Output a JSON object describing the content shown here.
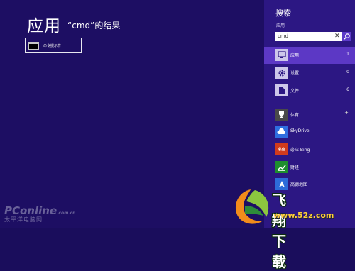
{
  "main": {
    "title": "应用",
    "subtitle": "“cmd”的结果",
    "results": [
      {
        "label": "命令提示符",
        "icon": "command-prompt-icon"
      }
    ]
  },
  "search_panel": {
    "title": "搜索",
    "scope_label": "应用",
    "search_value": "cmd",
    "clear_icon": "close-icon",
    "search_icon": "magnifier-icon",
    "categories": [
      {
        "label": "应用",
        "count": "1",
        "icon": "apps-icon",
        "selected": true
      },
      {
        "label": "设置",
        "count": "0",
        "icon": "gear-icon",
        "selected": false
      },
      {
        "label": "文件",
        "count": "6",
        "icon": "file-icon",
        "selected": false
      }
    ],
    "apps": [
      {
        "label": "体育",
        "icon": "trophy-icon",
        "color": "#4a4a4a",
        "pinned": true
      },
      {
        "label": "SkyDrive",
        "icon": "cloud-icon",
        "color": "#2f6ee0",
        "pinned": false
      },
      {
        "label": "必应 Bing",
        "icon": "bing-icon",
        "color": "#d13b1c",
        "pinned": false
      },
      {
        "label": "财经",
        "icon": "chart-icon",
        "color": "#1e8e2e",
        "pinned": false
      },
      {
        "label": "高德地图",
        "icon": "map-icon",
        "color": "#2d6bd9",
        "pinned": false
      }
    ]
  },
  "watermarks": {
    "left_brand": "PConline",
    "left_domain": ".com.cn",
    "left_sub": "太平洋电脑网",
    "right_brand": "飞翔下载",
    "right_url": "www.52z.com"
  },
  "colors": {
    "background": "#1d0e63",
    "panel": "#2c1783",
    "selected": "#5c38c5"
  }
}
